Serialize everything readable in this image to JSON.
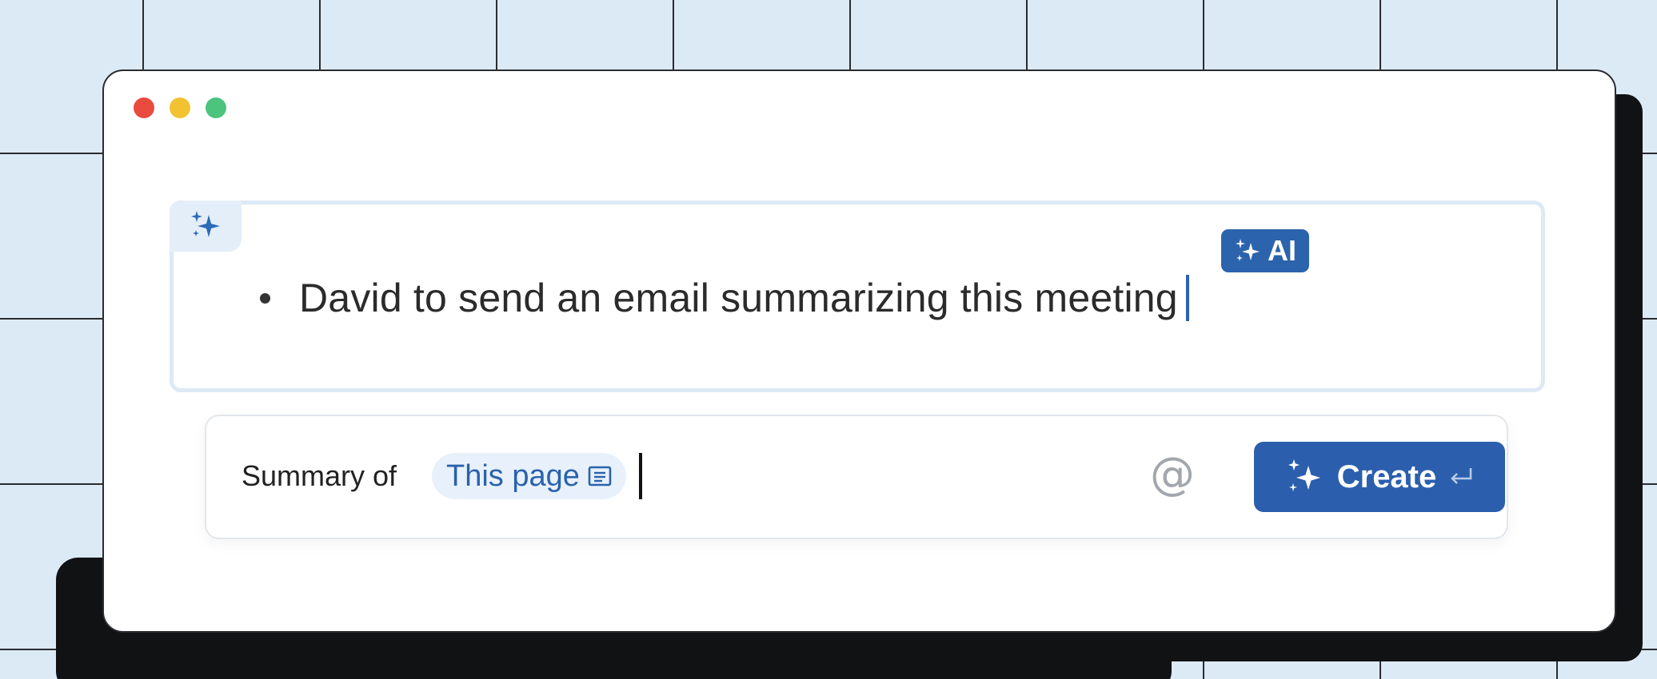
{
  "window": {
    "controls": [
      "close",
      "minimize",
      "maximize"
    ]
  },
  "ai_block": {
    "icon": "sparkles-icon",
    "badge_label": "AI",
    "bullet_text": "David to send an email summarizing this meeting"
  },
  "prompt": {
    "label": "Summary of",
    "chip_label": "This page",
    "chip_icon": "page-icon",
    "mention_symbol": "@",
    "create_label": "Create",
    "create_icon": "sparkles-icon",
    "enter_icon": "enter-key-icon"
  },
  "colors": {
    "accent": "#2b5fae",
    "chip_bg": "#e8f1fb",
    "close": "#ea4b3f",
    "minimize": "#f2c230",
    "maximize": "#4cc47e"
  }
}
